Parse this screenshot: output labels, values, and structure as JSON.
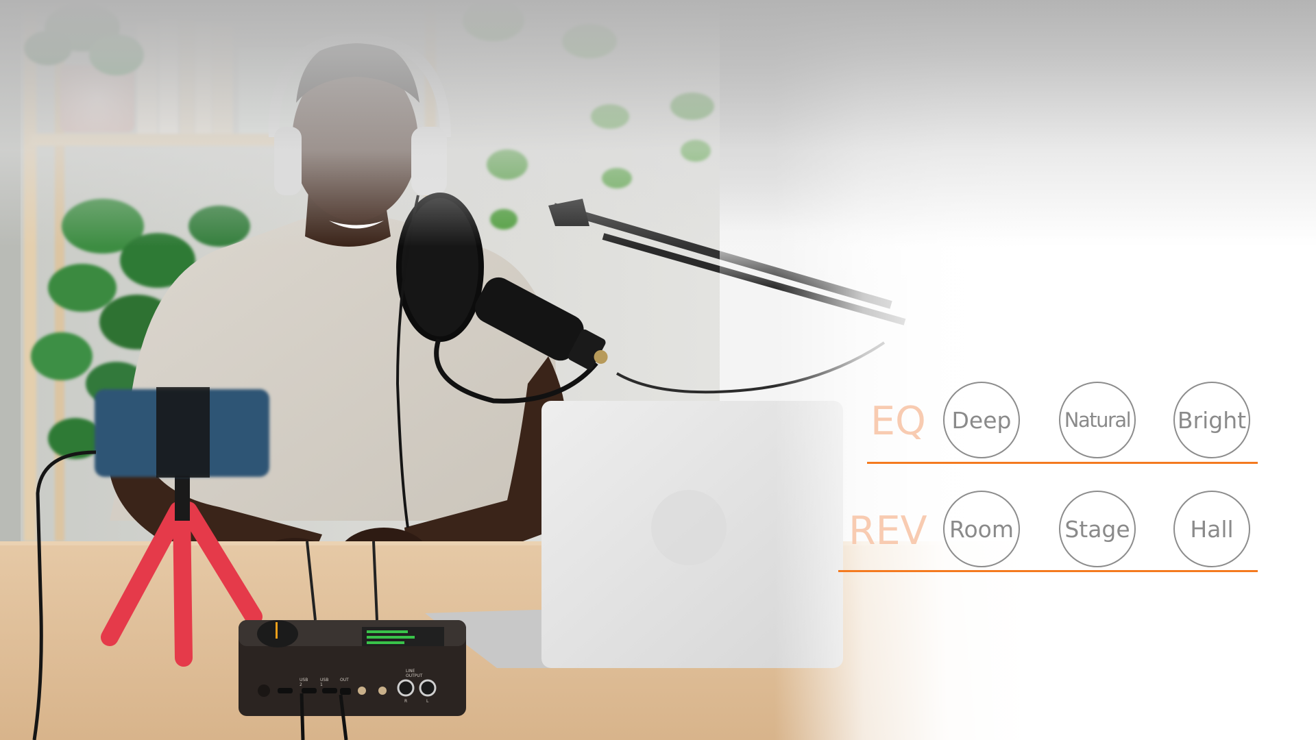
{
  "banner": {
    "accent_color": "#f47a1f",
    "label_color": "#f8cbb1",
    "option_color": "#8a8a8a",
    "rows": [
      {
        "label": "EQ",
        "options": [
          "Deep",
          "Natural",
          "Bright"
        ]
      },
      {
        "label": "REV",
        "options": [
          "Room",
          "Stage",
          "Hall"
        ]
      }
    ]
  },
  "device": {
    "ports": [
      "USB 2",
      "USB 1",
      "OUT"
    ],
    "line_output_label": "LINE OUTPUT",
    "line_output_channels": [
      "R",
      "L"
    ]
  }
}
